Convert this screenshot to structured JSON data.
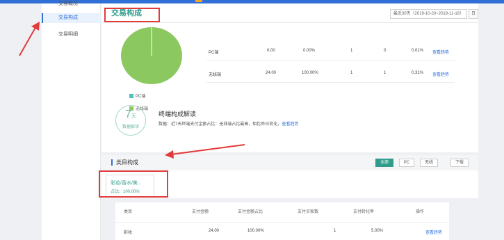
{
  "sidebar": {
    "items": [
      {
        "label": "交易概况"
      },
      {
        "label": "交易构成"
      },
      {
        "label": "交易明细"
      }
    ]
  },
  "header": {
    "title": "交易构成",
    "date_range": "最近30天（2019-10-20~2019-11-18）",
    "date_button": "日"
  },
  "terminal": {
    "legend": [
      {
        "label": "PC端",
        "color": "#4fc1c0"
      },
      {
        "label": "无线端",
        "color": "#8bc860"
      }
    ],
    "rows": [
      {
        "name": "PC端",
        "amount": "0.00",
        "amount_pct": "0.00%",
        "buyers": "1",
        "orders": "0",
        "conversion": "0.01%",
        "link": "查看趋势"
      },
      {
        "name": "无线端",
        "amount": "24.00",
        "amount_pct": "100.00%",
        "buyers": "1",
        "orders": "1",
        "conversion": "0.31%",
        "link": "查看趋势"
      }
    ],
    "badge": {
      "num": "7",
      "unit": "天",
      "sub": "数据解读"
    },
    "interp_title": "终端构成解读",
    "interp_text": "数据：近7天终端支付金额占比：无线端占比最高，相比昨日变化，",
    "interp_link": "查看趋势"
  },
  "category": {
    "title": "类目构成",
    "segments": [
      {
        "label": "全部",
        "active": true
      },
      {
        "label": "PC",
        "active": false
      },
      {
        "label": "无线",
        "active": false
      }
    ],
    "download": "下载",
    "card": {
      "name": "彩妆/香水/美...",
      "pct": "占比：100.00%"
    },
    "headers": [
      "类目",
      "支付金额",
      "支付金额占比",
      "支付买家数",
      "支付转化率",
      "操作"
    ],
    "row": {
      "name": "彩妆",
      "amount": "24.00",
      "pct": "100.00%",
      "buyers": "1",
      "conversion": "5.00%",
      "link": "查看趋势"
    }
  },
  "colors": {
    "accent": "#2f6fd6",
    "teal": "#2f9c8c",
    "annotation": "#e23b3b",
    "pie_main": "#8bc860"
  }
}
